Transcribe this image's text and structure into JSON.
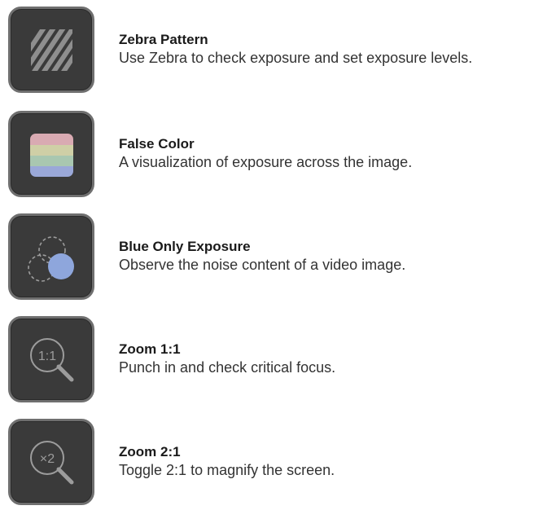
{
  "features": [
    {
      "icon": "zebra-stripes-icon",
      "title": "Zebra Pattern",
      "description": "Use Zebra to check exposure and set exposure levels."
    },
    {
      "icon": "false-color-icon",
      "title": "False Color",
      "description": "A visualization of exposure across the image."
    },
    {
      "icon": "blue-only-circles-icon",
      "title": "Blue Only Exposure",
      "description": "Observe the noise content of a video image."
    },
    {
      "icon": "magnifier-1to1-icon",
      "icon_text": "1:1",
      "title": "Zoom 1:1",
      "description": "Punch in and check critical focus."
    },
    {
      "icon": "magnifier-2x-icon",
      "icon_text": "×2",
      "title": "Zoom 2:1",
      "description": "Toggle 2:1 to magnify the screen."
    }
  ],
  "colors": {
    "tile_background": "#3a3a3a",
    "tile_border": "#6f6f6f",
    "zebra_stripe": "#8e8e8e",
    "false_color_bands": [
      "#d9aab2",
      "#cfcfa6",
      "#a9c7b0",
      "#9aa8d8"
    ],
    "blue_circle": "#8ea6dc",
    "icon_line": "#9c9c9c"
  }
}
